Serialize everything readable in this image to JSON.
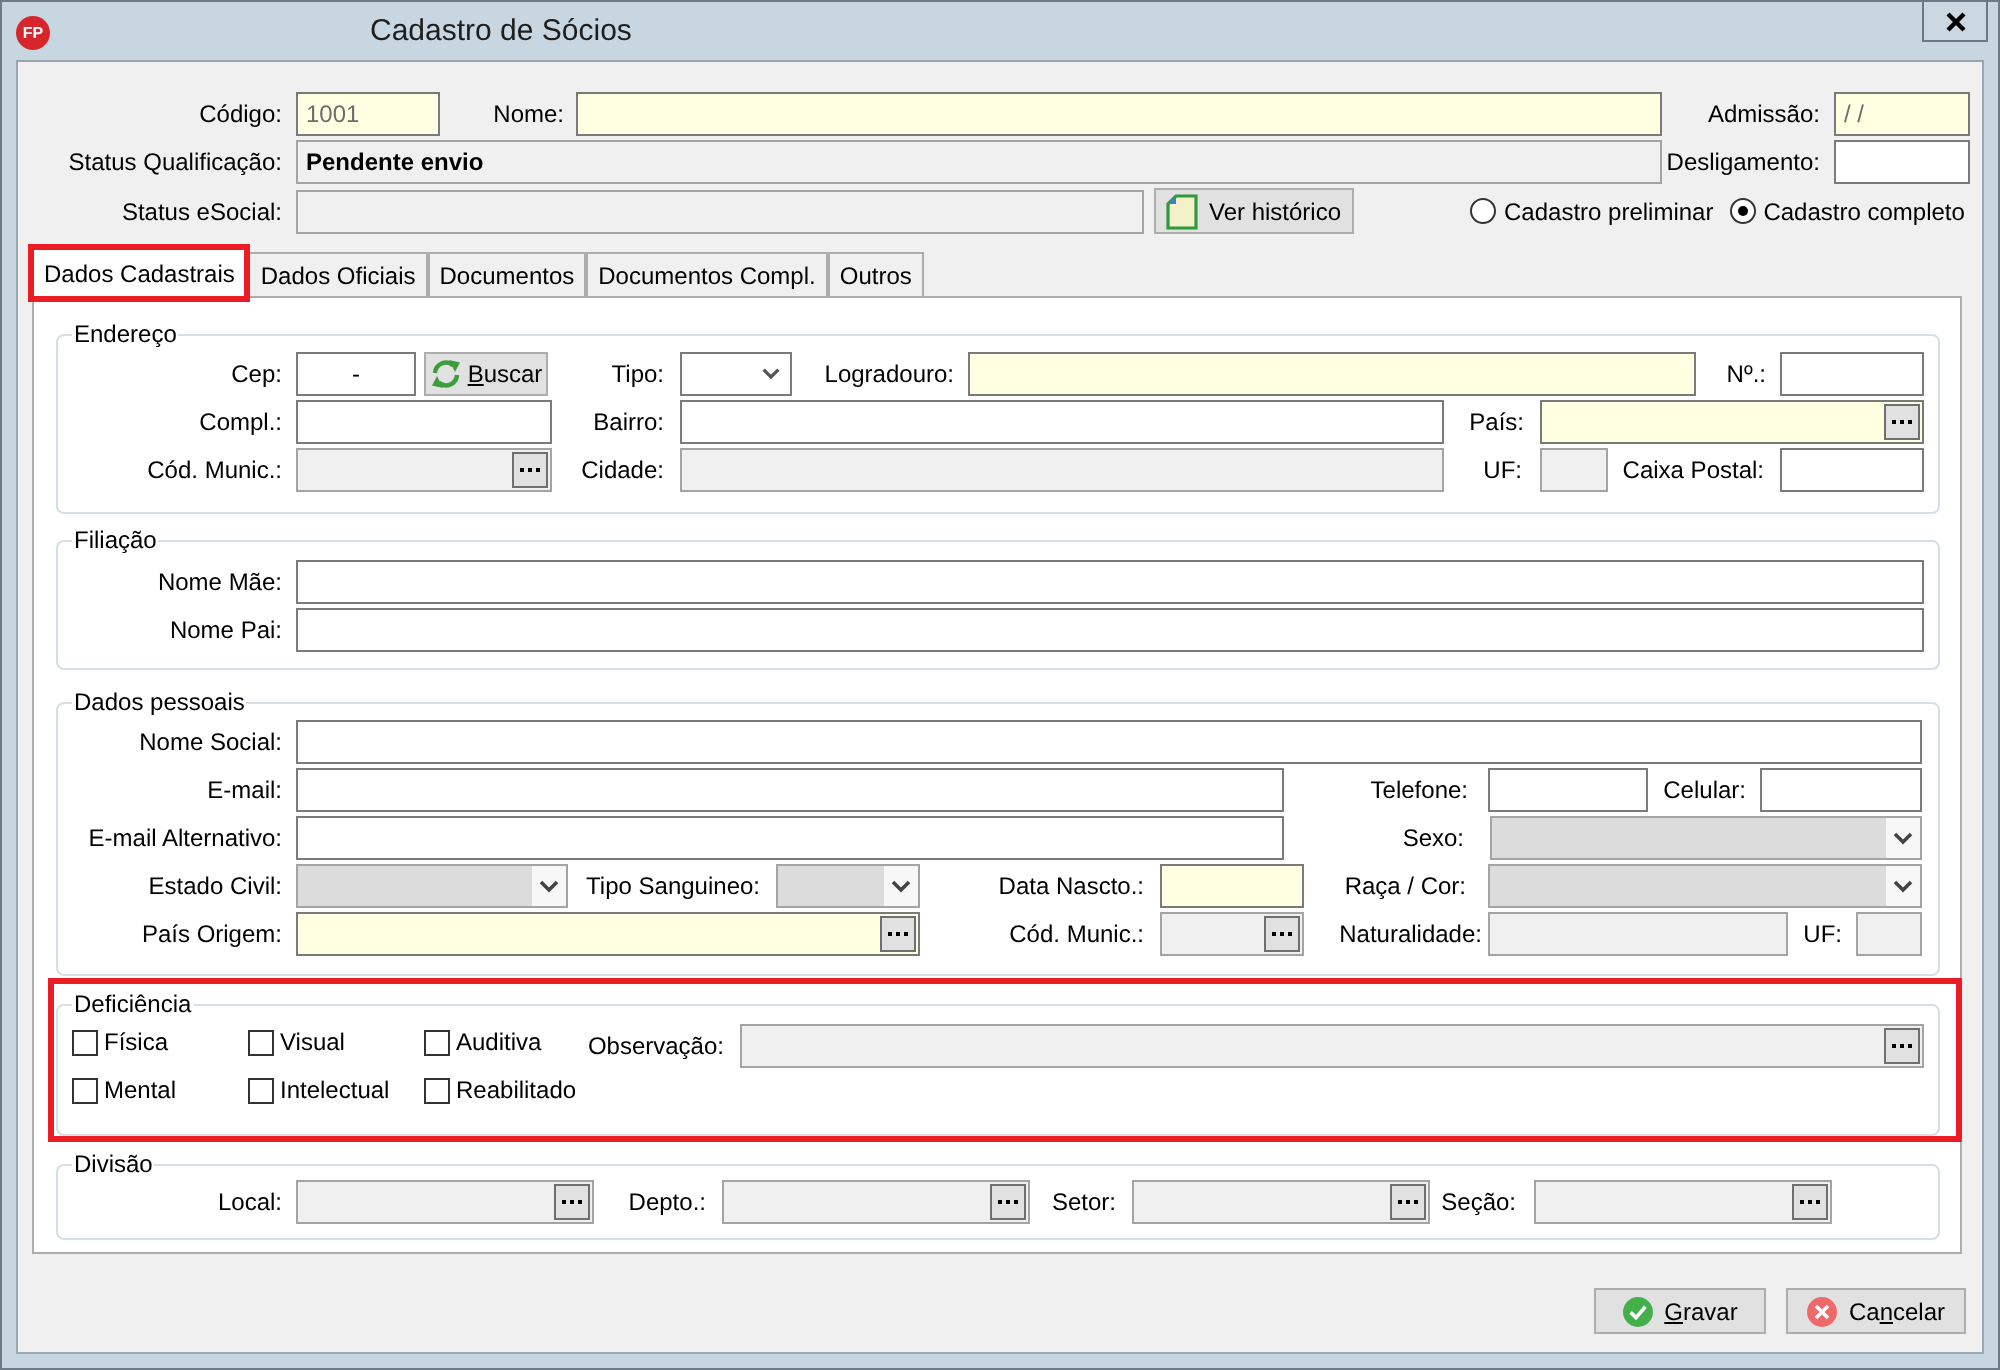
{
  "window": {
    "logo": "FP",
    "title": "Cadastro de Sócios"
  },
  "header": {
    "fields": {
      "codigo": {
        "label": "Código:",
        "kind": "text",
        "required": true,
        "disabled": false,
        "value": "1001"
      },
      "nome": {
        "label": "Nome:",
        "kind": "text",
        "required": true,
        "disabled": false
      },
      "admissao": {
        "label": "Admissão:",
        "kind": "text",
        "required": true,
        "disabled": false,
        "value": "/ /"
      },
      "status_qualificacao": {
        "label": "Status Qualificação:",
        "kind": "text",
        "required": false,
        "disabled": true,
        "value": "Pendente envio"
      },
      "desligamento": {
        "label": "Desligamento:",
        "kind": "text",
        "required": false,
        "disabled": false
      },
      "status_esocial": {
        "label": "Status eSocial:",
        "kind": "text",
        "required": false,
        "disabled": true
      }
    },
    "history_button": {
      "label": "Ver histórico"
    },
    "record_type": [
      {
        "label": "Cadastro preliminar",
        "selected": false
      },
      {
        "label": "Cadastro completo",
        "selected": true
      }
    ]
  },
  "tabs": [
    {
      "label": "Dados Cadastrais",
      "selected": true,
      "highlighted": true
    },
    {
      "label": "Dados Oficiais",
      "selected": false,
      "highlighted": false
    },
    {
      "label": "Documentos",
      "selected": false,
      "highlighted": false
    },
    {
      "label": "Documentos Compl.",
      "selected": false,
      "highlighted": false
    },
    {
      "label": "Outros",
      "selected": false,
      "highlighted": false
    }
  ],
  "groups": [
    {
      "kind": "address",
      "title": "Endereço",
      "highlighted": false,
      "search_button": {
        "label_parts": [
          {
            "text": "B",
            "underlined": true
          },
          {
            "text": "uscar",
            "underlined": false
          }
        ]
      },
      "fields": {
        "cep": {
          "label": "Cep:",
          "kind": "text",
          "required": false,
          "disabled": false,
          "value": "-"
        },
        "tipo": {
          "label": "Tipo:",
          "kind": "select",
          "required": false,
          "disabled": false
        },
        "logradouro": {
          "label": "Logradouro:",
          "kind": "text",
          "required": true,
          "disabled": false
        },
        "numero": {
          "label": "Nº.:",
          "kind": "text",
          "required": false,
          "disabled": false
        },
        "compl": {
          "label": "Compl.:",
          "kind": "text",
          "required": false,
          "disabled": false
        },
        "bairro": {
          "label": "Bairro:",
          "kind": "text",
          "required": false,
          "disabled": false
        },
        "pais": {
          "label": "País:",
          "kind": "lookup",
          "required": true,
          "disabled": false
        },
        "cod_munic": {
          "label": "Cód. Munic.:",
          "kind": "lookup",
          "required": false,
          "disabled": true
        },
        "cidade": {
          "label": "Cidade:",
          "kind": "text",
          "required": false,
          "disabled": true
        },
        "uf": {
          "label": "UF:",
          "kind": "text",
          "required": false,
          "disabled": true
        },
        "caixa_postal": {
          "label": "Caixa Postal:",
          "kind": "text",
          "required": false,
          "disabled": false
        }
      }
    },
    {
      "kind": "parentage",
      "title": "Filiação",
      "highlighted": false,
      "fields": {
        "nome_mae": {
          "label": "Nome Mãe:",
          "kind": "text",
          "required": false,
          "disabled": false
        },
        "nome_pai": {
          "label": "Nome Pai:",
          "kind": "text",
          "required": false,
          "disabled": false
        }
      }
    },
    {
      "kind": "personal",
      "title": "Dados pessoais",
      "highlighted": false,
      "fields": {
        "nome_social": {
          "label": "Nome Social:",
          "kind": "text",
          "required": false,
          "disabled": false
        },
        "email": {
          "label": "E-mail:",
          "kind": "text",
          "required": false,
          "disabled": false
        },
        "telefone": {
          "label": "Telefone:",
          "kind": "text",
          "required": false,
          "disabled": false
        },
        "celular": {
          "label": "Celular:",
          "kind": "text",
          "required": false,
          "disabled": false
        },
        "email_alternativo": {
          "label": "E-mail Alternativo:",
          "kind": "text",
          "required": false,
          "disabled": false
        },
        "sexo": {
          "label": "Sexo:",
          "kind": "select",
          "required": false,
          "disabled": true
        },
        "estado_civil": {
          "label": "Estado Civil:",
          "kind": "select",
          "required": false,
          "disabled": true
        },
        "tipo_sanguineo": {
          "label": "Tipo Sanguineo:",
          "kind": "select",
          "required": false,
          "disabled": true
        },
        "data_nascto": {
          "label": "Data Nascto.:",
          "kind": "text",
          "required": true,
          "disabled": false
        },
        "raca_cor": {
          "label": "Raça / Cor:",
          "kind": "select",
          "required": false,
          "disabled": true
        },
        "pais_origem": {
          "label": "País Origem:",
          "kind": "lookup",
          "required": true,
          "disabled": false
        },
        "cod_munic": {
          "label": "Cód. Munic.:",
          "kind": "lookup",
          "required": false,
          "disabled": true
        },
        "naturalidade": {
          "label": "Naturalidade:",
          "kind": "text",
          "required": false,
          "disabled": true
        },
        "uf": {
          "label": "UF:",
          "kind": "text",
          "required": false,
          "disabled": true
        }
      }
    },
    {
      "kind": "disability",
      "title": "Deficiência",
      "highlighted": true,
      "options": [
        {
          "label": "Física",
          "checked": false
        },
        {
          "label": "Visual",
          "checked": false
        },
        {
          "label": "Auditiva",
          "checked": false
        },
        {
          "label": "Mental",
          "checked": false
        },
        {
          "label": "Intelectual",
          "checked": false
        },
        {
          "label": "Reabilitado",
          "checked": false
        }
      ],
      "fields": {
        "observacao": {
          "label": "Observação:",
          "kind": "lookup",
          "required": false,
          "disabled": true
        }
      }
    },
    {
      "kind": "division",
      "title": "Divisão",
      "highlighted": false,
      "fields": {
        "local": {
          "label": "Local:",
          "kind": "lookup",
          "required": false,
          "disabled": true
        },
        "depto": {
          "label": "Depto.:",
          "kind": "lookup",
          "required": false,
          "disabled": true
        },
        "setor": {
          "label": "Setor:",
          "kind": "lookup",
          "required": false,
          "disabled": true
        },
        "secao": {
          "label": "Seção:",
          "kind": "lookup",
          "required": false,
          "disabled": true
        }
      }
    }
  ],
  "buttons": [
    {
      "kind": "save",
      "label_parts": [
        {
          "text": "G",
          "underlined": true
        },
        {
          "text": "ravar",
          "underlined": false
        }
      ]
    },
    {
      "kind": "cancel",
      "label_parts": [
        {
          "text": "Ca",
          "underlined": false
        },
        {
          "text": "n",
          "underlined": true
        },
        {
          "text": "celar",
          "underlined": false
        }
      ]
    }
  ]
}
